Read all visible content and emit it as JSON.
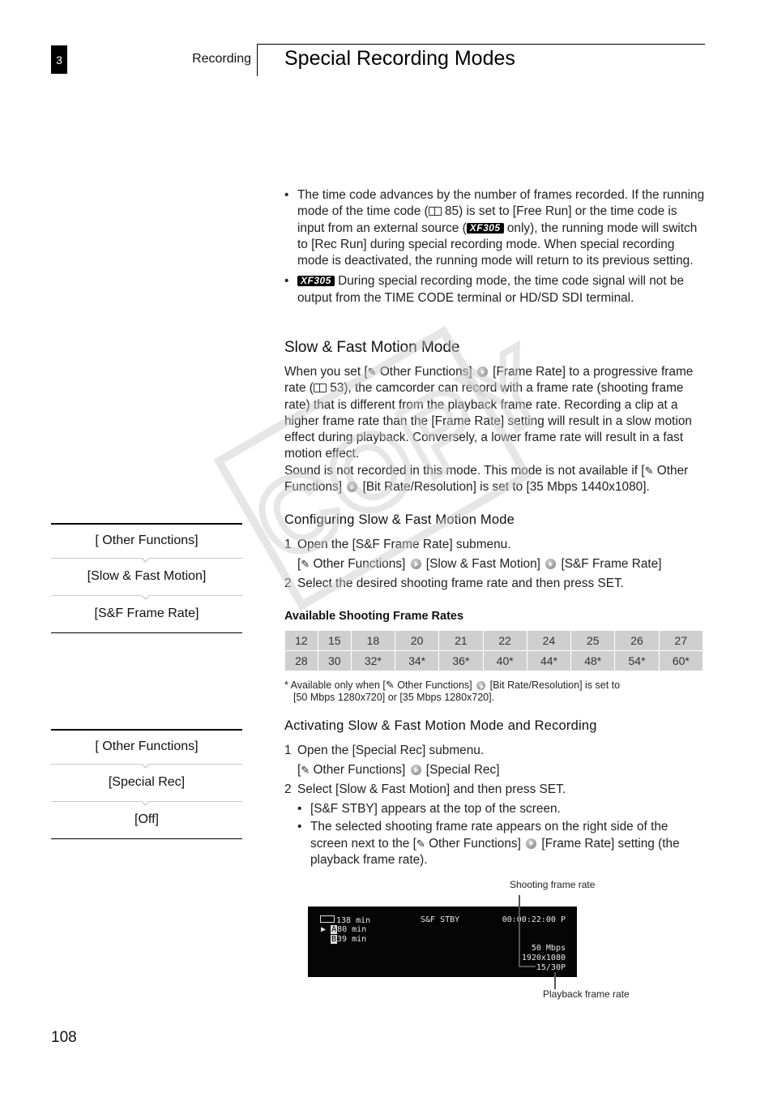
{
  "header": {
    "chapter_number": "3",
    "chapter_name": "Recording",
    "page_title": "Special Recording Modes"
  },
  "intro_bullets": [
    {
      "parts": {
        "a": "The time code advances by the number of frames recorded. If the running mode of the time code (",
        "ref": "85",
        "b": ") is set to [Free Run] or the time code is input from an external source (",
        "badge": "XF305",
        "c": " only), the running mode will switch to [Rec Run] during special recording mode. When special recording mode is deactivated, the running mode will return to its previous setting."
      }
    },
    {
      "parts": {
        "badge": "XF305",
        "a": " During special recording mode, the time code signal will not be output from the TIME CODE terminal or HD/SD SDI terminal."
      }
    }
  ],
  "section": {
    "title": "Slow & Fast Motion Mode",
    "para1": {
      "a": "When you set [",
      "menu1": " Other Functions]",
      "b": " [Frame Rate] to a progressive frame rate (",
      "ref": "53",
      "c": "), the camcorder can record with a frame rate (shooting frame rate) that is different from the playback frame rate. Recording a clip at a higher frame rate than the [Frame Rate] setting will result in a slow motion effect during playback. Conversely, a lower frame rate will result in a fast motion effect."
    },
    "para2": {
      "a": "Sound is not recorded in this mode. This mode is not available if [",
      "menu1": " Other Functions]",
      "b": " [Bit Rate/Resolution] is set to [35 Mbps 1440x1080]."
    }
  },
  "configuring": {
    "title": "Configuring Slow & Fast Motion Mode",
    "step1": {
      "num": "1",
      "text": "Open the [S&F Frame Rate] submenu."
    },
    "step1_path": {
      "a": "[",
      "b": " Other Functions]",
      "c": " [Slow & Fast Motion]",
      "d": " [S&F Frame Rate]"
    },
    "step2": {
      "num": "2",
      "text": "Select the desired shooting frame rate and then press SET."
    },
    "table_title": "Available Shooting Frame Rates",
    "rates_row1": [
      "12",
      "15",
      "18",
      "20",
      "21",
      "22",
      "24",
      "25",
      "26",
      "27"
    ],
    "rates_row2": [
      "28",
      "30",
      "32*",
      "34*",
      "36*",
      "40*",
      "44*",
      "48*",
      "54*",
      "60*"
    ],
    "footnote": {
      "a": "*  Available only when [",
      "b": " Other Functions]",
      "c": " [Bit Rate/Resolution] is set to",
      "d": "[50 Mbps 1280x720] or [35 Mbps 1280x720]."
    }
  },
  "activating": {
    "title": "Activating Slow & Fast Motion Mode and Recording",
    "step1": {
      "num": "1",
      "text": "Open the [Special Rec] submenu."
    },
    "step1_path": {
      "a": "[",
      "b": " Other Functions]",
      "c": " [Special Rec]"
    },
    "step2": {
      "num": "2",
      "text": "Select [Slow & Fast Motion] and then press SET."
    },
    "bullets": [
      "[S&F STBY] appears at the top of the screen.",
      {
        "a": "The selected shooting frame rate appears on the right side of the screen next to the [",
        "b": " Other Functions]",
        "c": " [Frame Rate] setting (the playback frame rate)."
      }
    ]
  },
  "sidebar_menus": [
    {
      "items": [
        "[ Other Functions]",
        "[Slow & Fast Motion]",
        "[S&F Frame Rate]"
      ]
    },
    {
      "items": [
        "[ Other Functions]",
        "[Special Rec]",
        "[Off]"
      ]
    }
  ],
  "screen_figure": {
    "battery_time": "138 min",
    "media_a": "80 min",
    "media_b": "39 min",
    "status": "S&F STBY",
    "timecode": "00:00:22:00 P",
    "bitrate": "50 Mbps",
    "resolution": "1920x1080",
    "frame_rate": "15/30P",
    "callout_shooting": "Shooting frame rate",
    "callout_playback": "Playback frame rate"
  },
  "watermark": "COPY",
  "page_number": "108"
}
